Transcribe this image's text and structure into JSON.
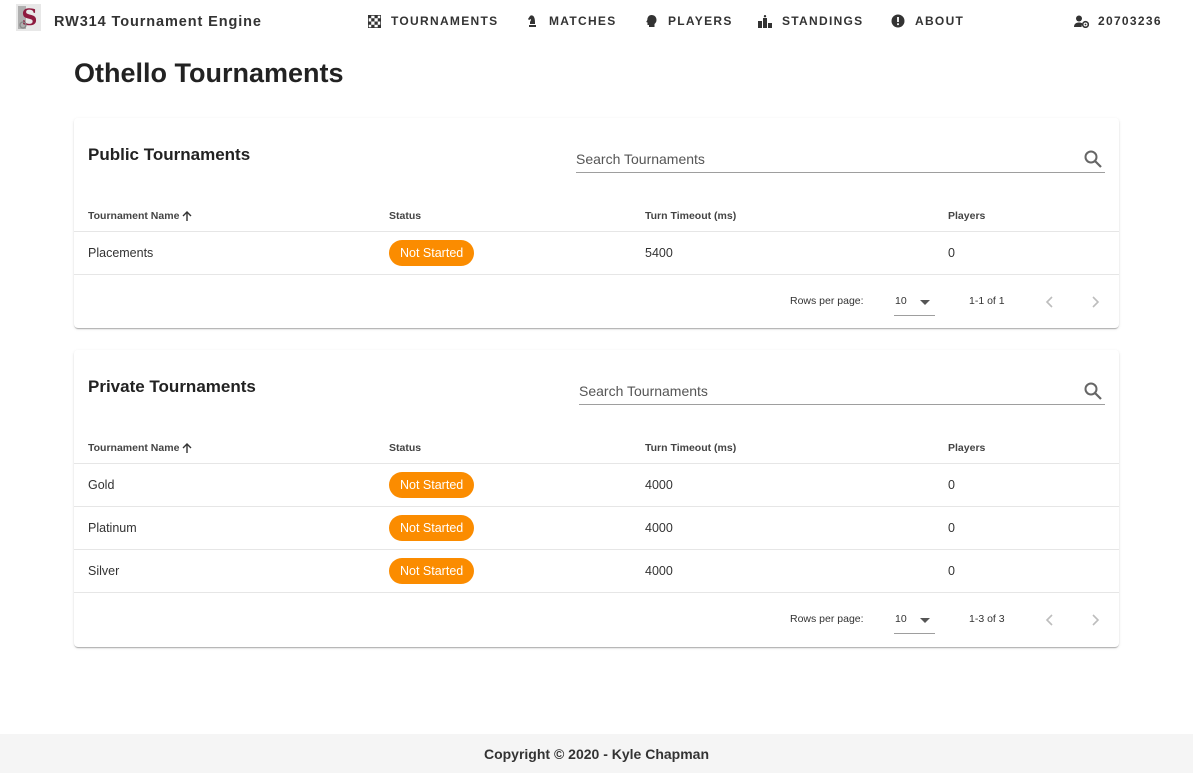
{
  "app": {
    "title": "RW314 Tournament Engine",
    "logo_letter": "S"
  },
  "nav": {
    "items": [
      {
        "label": "TOURNAMENTS",
        "icon": "checkerboard-icon"
      },
      {
        "label": "MATCHES",
        "icon": "chess-knight-icon"
      },
      {
        "label": "PLAYERS",
        "icon": "head-icon"
      },
      {
        "label": "STANDINGS",
        "icon": "podium-icon"
      },
      {
        "label": "ABOUT",
        "icon": "info-exclamation-icon"
      }
    ],
    "user": {
      "label": "20703236",
      "icon": "user-settings-icon"
    }
  },
  "page": {
    "title": "Othello Tournaments"
  },
  "public_table": {
    "title": "Public Tournaments",
    "search_placeholder": "Search Tournaments",
    "columns": [
      "Tournament Name",
      "Status",
      "Turn Timeout (ms)",
      "Players"
    ],
    "rows": [
      {
        "name": "Placements",
        "status": "Not Started",
        "timeout": "5400",
        "players": "0"
      }
    ],
    "rows_per_page_label": "Rows per page:",
    "rows_per_page": "10",
    "range": "1-1 of 1"
  },
  "private_table": {
    "title": "Private Tournaments",
    "search_placeholder": "Search Tournaments",
    "columns": [
      "Tournament Name",
      "Status",
      "Turn Timeout (ms)",
      "Players"
    ],
    "rows": [
      {
        "name": "Gold",
        "status": "Not Started",
        "timeout": "4000",
        "players": "0"
      },
      {
        "name": "Platinum",
        "status": "Not Started",
        "timeout": "4000",
        "players": "0"
      },
      {
        "name": "Silver",
        "status": "Not Started",
        "timeout": "4000",
        "players": "0"
      }
    ],
    "rows_per_page_label": "Rows per page:",
    "rows_per_page": "10",
    "range": "1-3 of 3"
  },
  "footer": {
    "text": "Copyright © 2020 - Kyle Chapman"
  },
  "colors": {
    "status_not_started": "#fb8c00",
    "logo_accent": "#8e1b3f"
  }
}
